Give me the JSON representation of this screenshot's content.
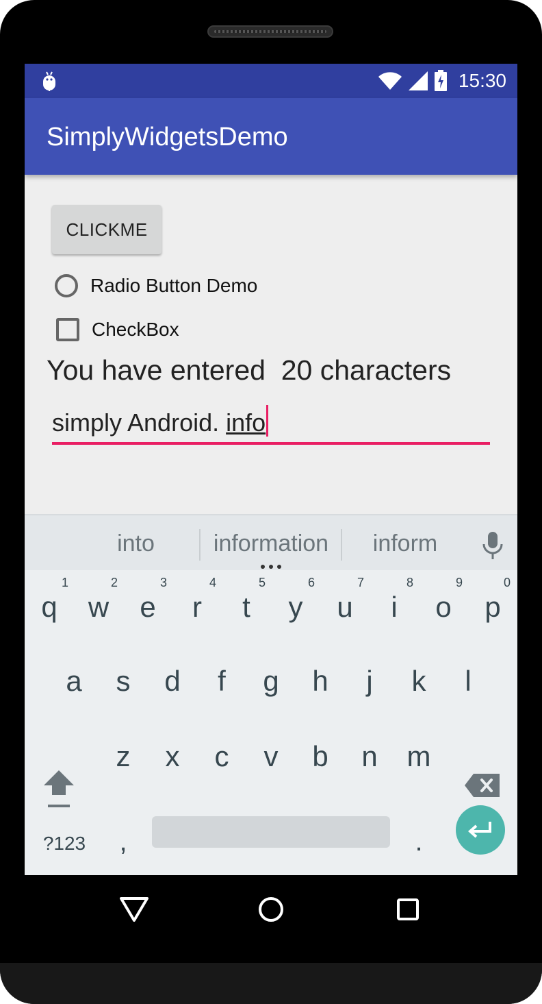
{
  "statusbar": {
    "time": "15:30"
  },
  "appbar": {
    "title": "SimplyWidgetsDemo"
  },
  "main": {
    "button_label": "CLICKME",
    "radio_label": "Radio Button Demo",
    "checkbox_label": "CheckBox",
    "counter_text": "You have entered  20 characters",
    "edit_text_prefix": "simply Android. ",
    "edit_text_composing": "info"
  },
  "keyboard": {
    "suggestions": [
      "into",
      "information",
      "inform"
    ],
    "row1": [
      {
        "letter": "q",
        "hint": "1"
      },
      {
        "letter": "w",
        "hint": "2"
      },
      {
        "letter": "e",
        "hint": "3"
      },
      {
        "letter": "r",
        "hint": "4"
      },
      {
        "letter": "t",
        "hint": "5"
      },
      {
        "letter": "y",
        "hint": "6"
      },
      {
        "letter": "u",
        "hint": "7"
      },
      {
        "letter": "i",
        "hint": "8"
      },
      {
        "letter": "o",
        "hint": "9"
      },
      {
        "letter": "p",
        "hint": "0"
      }
    ],
    "row2": [
      "a",
      "s",
      "d",
      "f",
      "g",
      "h",
      "j",
      "k",
      "l"
    ],
    "row3": [
      "z",
      "x",
      "c",
      "v",
      "b",
      "n",
      "m"
    ],
    "symbols_label": "?123",
    "comma": ",",
    "period": ".",
    "icons": [
      "microphone-icon",
      "shift-icon",
      "backspace-icon",
      "enter-icon"
    ]
  },
  "icons": {
    "status": [
      "android-debug-icon",
      "wifi-icon",
      "cell-signal-icon",
      "battery-charging-icon"
    ],
    "nav": [
      "back-icon",
      "home-icon",
      "recents-icon"
    ]
  },
  "colors": {
    "status_bar": "#303f9f",
    "app_bar": "#3f51b5",
    "accent": "#e91e63",
    "enter_key": "#4db6ac"
  }
}
